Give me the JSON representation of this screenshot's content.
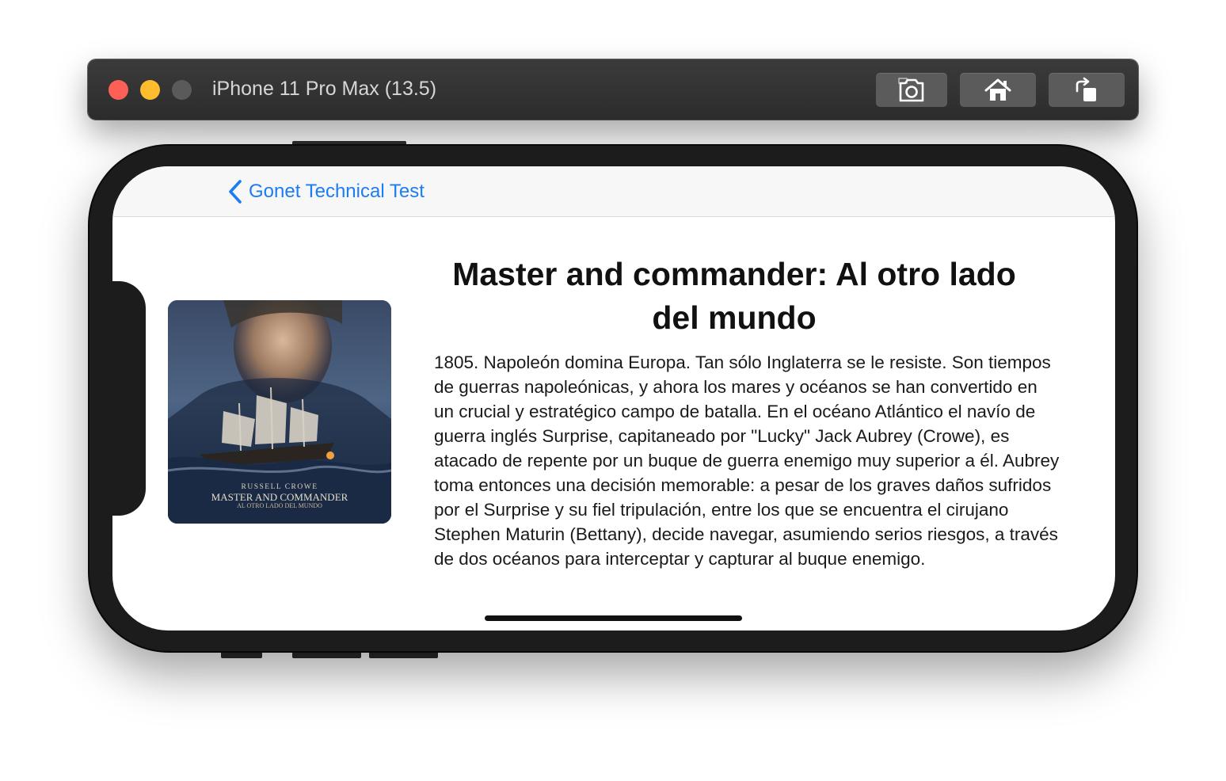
{
  "simulator": {
    "device_title": "iPhone 11 Pro Max (13.5)",
    "buttons": [
      {
        "name": "screenshot",
        "icon": "camera-icon"
      },
      {
        "name": "home",
        "icon": "home-icon"
      },
      {
        "name": "rotate",
        "icon": "rotate-icon"
      }
    ]
  },
  "navbar": {
    "back_label": "Gonet Technical Test",
    "accent_color": "#1b7cf5"
  },
  "movie": {
    "title": "Master and commander: Al otro lado del mundo",
    "overview": "1805. Napoleón domina Europa. Tan sólo Inglaterra se le resiste. Son tiempos de guerras napoleónicas, y ahora los mares y océanos se han convertido en un crucial y estratégico campo de batalla. En el océano Atlántico el navío de guerra inglés Surprise, capitaneado por \"Lucky\" Jack Aubrey (Crowe), es atacado de repente por un buque de guerra enemigo muy superior a él. Aubrey toma entonces una decisión memorable: a pesar de los graves daños sufridos por el Surprise y su fiel tripulación, entre los que se encuentra el cirujano Stephen Maturin (Bettany), decide navegar, asumiendo serios riesgos, a través de dos océanos para interceptar y capturar al buque enemigo.",
    "poster": {
      "actor": "RUSSELL CROWE",
      "title_line1": "MASTER AND COMMANDER",
      "title_line2": "AL OTRO LADO DEL MUNDO"
    }
  }
}
